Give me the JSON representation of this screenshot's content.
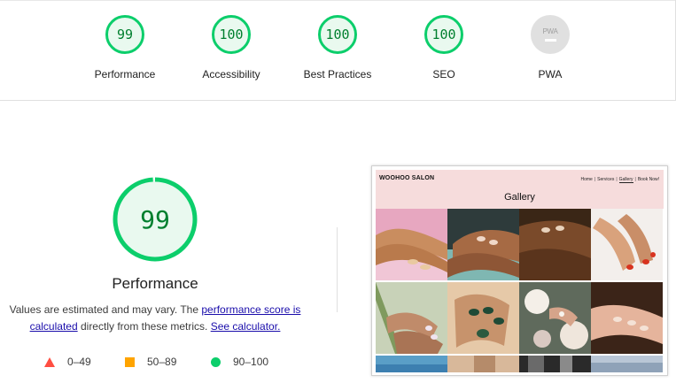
{
  "summary": {
    "gauges": [
      {
        "score": "99",
        "label": "Performance"
      },
      {
        "score": "100",
        "label": "Accessibility"
      },
      {
        "score": "100",
        "label": "Best Practices"
      },
      {
        "score": "100",
        "label": "SEO"
      },
      {
        "score": "PWA",
        "label": "PWA",
        "status": "not-applicable"
      }
    ]
  },
  "main": {
    "score": 99,
    "score_text": "99",
    "title": "Performance",
    "desc_prefix": "Values are estimated and may vary. The ",
    "link_score": "performance score is calculated",
    "desc_middle": " directly from these metrics. ",
    "link_calc": "See calculator."
  },
  "legend": [
    {
      "icon": "triangle-icon",
      "range": "0–49",
      "color": "#ff4e42"
    },
    {
      "icon": "square-icon",
      "range": "50–89",
      "color": "#ffa400"
    },
    {
      "icon": "circle-icon",
      "range": "90–100",
      "color": "#0cce6b"
    }
  ],
  "screenshot": {
    "site_name": "WOOHOO SALON",
    "nav": [
      "Home",
      "Services",
      "Gallery",
      "Book Now!"
    ],
    "heading": "Gallery"
  },
  "colors": {
    "pass": "#0cce6b",
    "pass_text": "#007f2e",
    "pass_bg": "#e9f9ef",
    "average": "#ffa400",
    "fail": "#ff4e42",
    "link": "#1a0dab",
    "site_header_bg": "#f6dcdc"
  }
}
